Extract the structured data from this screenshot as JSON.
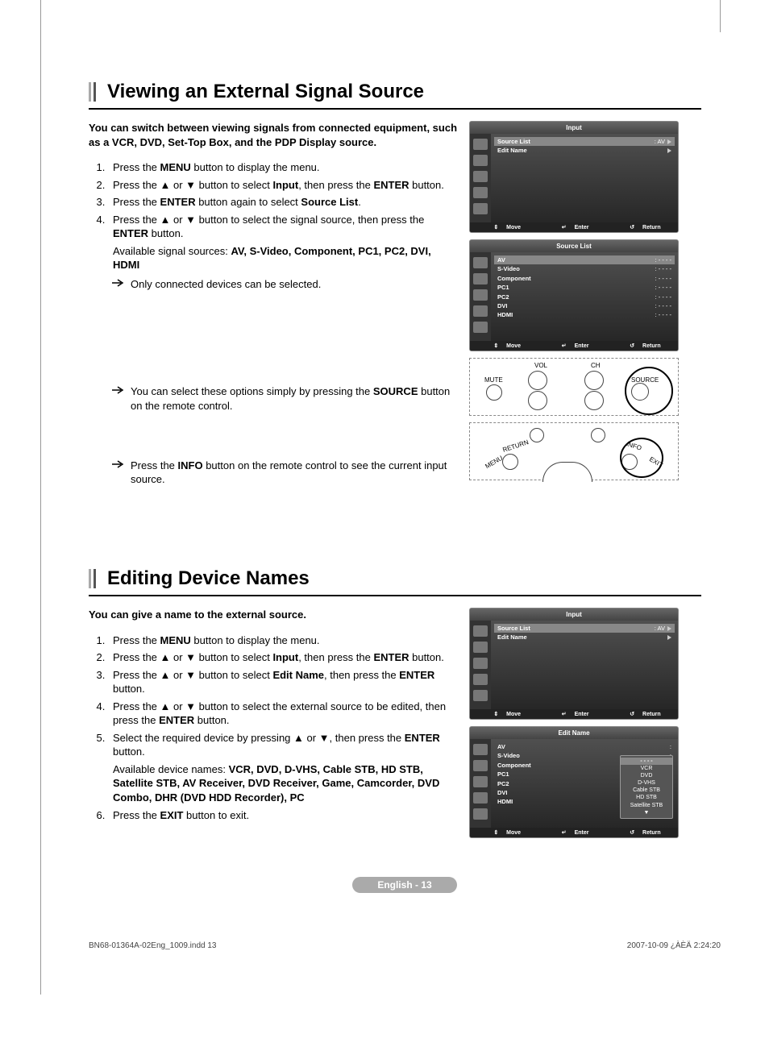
{
  "section1": {
    "title": "Viewing an External Signal Source",
    "intro": "You can switch between viewing signals from connected equipment, such as a VCR, DVD, Set-Top Box, and the PDP Display source.",
    "steps": {
      "s1a": "Press the ",
      "s1b": "MENU",
      "s1c": " button to display the menu.",
      "s2a": "Press the ▲ or ▼ button to select ",
      "s2b": "Input",
      "s2c": ", then press the ",
      "s2d": "ENTER",
      "s2e": " button.",
      "s3a": "Press the ",
      "s3b": "ENTER",
      "s3c": " button again to select ",
      "s3d": "Source List",
      "s3e": ".",
      "s4a": "Press the ▲ or ▼ button to select the signal source, then press the ",
      "s4b": "ENTER",
      "s4c": " button.",
      "s4sub_a": "Available signal sources: ",
      "s4sub_list": "AV, S-Video, Component, PC1, PC2, DVI, HDMI",
      "note1": "Only connected devices can be selected."
    },
    "note_source_a": "You can select these options simply by pressing the ",
    "note_source_b": "SOURCE",
    "note_source_c": " button on the remote control.",
    "note_info_a": "Press the ",
    "note_info_b": "INFO",
    "note_info_c": " button on the remote control to see the current input source."
  },
  "section2": {
    "title": "Editing Device Names",
    "intro": "You can give a name to the external source.",
    "steps": {
      "s1a": "Press the ",
      "s1b": "MENU",
      "s1c": " button to display the menu.",
      "s2a": "Press the ▲ or ▼ button to select ",
      "s2b": "Input",
      "s2c": ", then press the ",
      "s2d": "ENTER",
      "s2e": " button.",
      "s3a": "Press the ▲ or ▼ button to select ",
      "s3b": "Edit Name",
      "s3c": ", then press the ",
      "s3d": "ENTER",
      "s3e": " button.",
      "s4a": "Press the ▲ or ▼ button to select the external source to be edited, then press the ",
      "s4b": "ENTER",
      "s4c": " button.",
      "s5a": "Select the required device by pressing ▲ or ▼, then press the ",
      "s5b": "ENTER",
      "s5c": " button.",
      "s5sub_a": "Available device names: ",
      "s5sub_list": "VCR, DVD, D-VHS, Cable STB, HD STB, Satellite STB, AV Receiver, DVD Receiver, Game, Camcorder, DVD Combo, DHR (DVD HDD Recorder), PC",
      "s6a": "Press the ",
      "s6b": "EXIT",
      "s6c": " button to exit."
    }
  },
  "osd": {
    "input_title": "Input",
    "source_list": "Source List",
    "edit_name": "Edit Name",
    "av": "AV",
    "av_value": ": AV",
    "dashes": "- - - -",
    "sources": {
      "av": "AV",
      "svideo": "S-Video",
      "component": "Component",
      "pc1": "PC1",
      "pc2": "PC2",
      "dvi": "DVI",
      "hdmi": "HDMI"
    },
    "foot_move": "Move",
    "foot_enter": "Enter",
    "foot_return": "Return",
    "popup": {
      "blank": "- - - -",
      "vcr": "VCR",
      "dvd": "DVD",
      "dvhs": "D-VHS",
      "cable": "Cable STB",
      "hdstb": "HD STB",
      "sat": "Satellite STB",
      "more": "▼"
    }
  },
  "remote": {
    "vol": "VOL",
    "ch": "CH",
    "mute": "MUTE",
    "source": "SOURCE",
    "return": "RETURN",
    "info": "INFO",
    "menu": "MENU",
    "exit": "EXIT"
  },
  "footer": {
    "page": "English - 13",
    "file": "BN68-01364A-02Eng_1009.indd   13",
    "date": "2007-10-09   ¿ÀÈÄ 2:24:20"
  }
}
